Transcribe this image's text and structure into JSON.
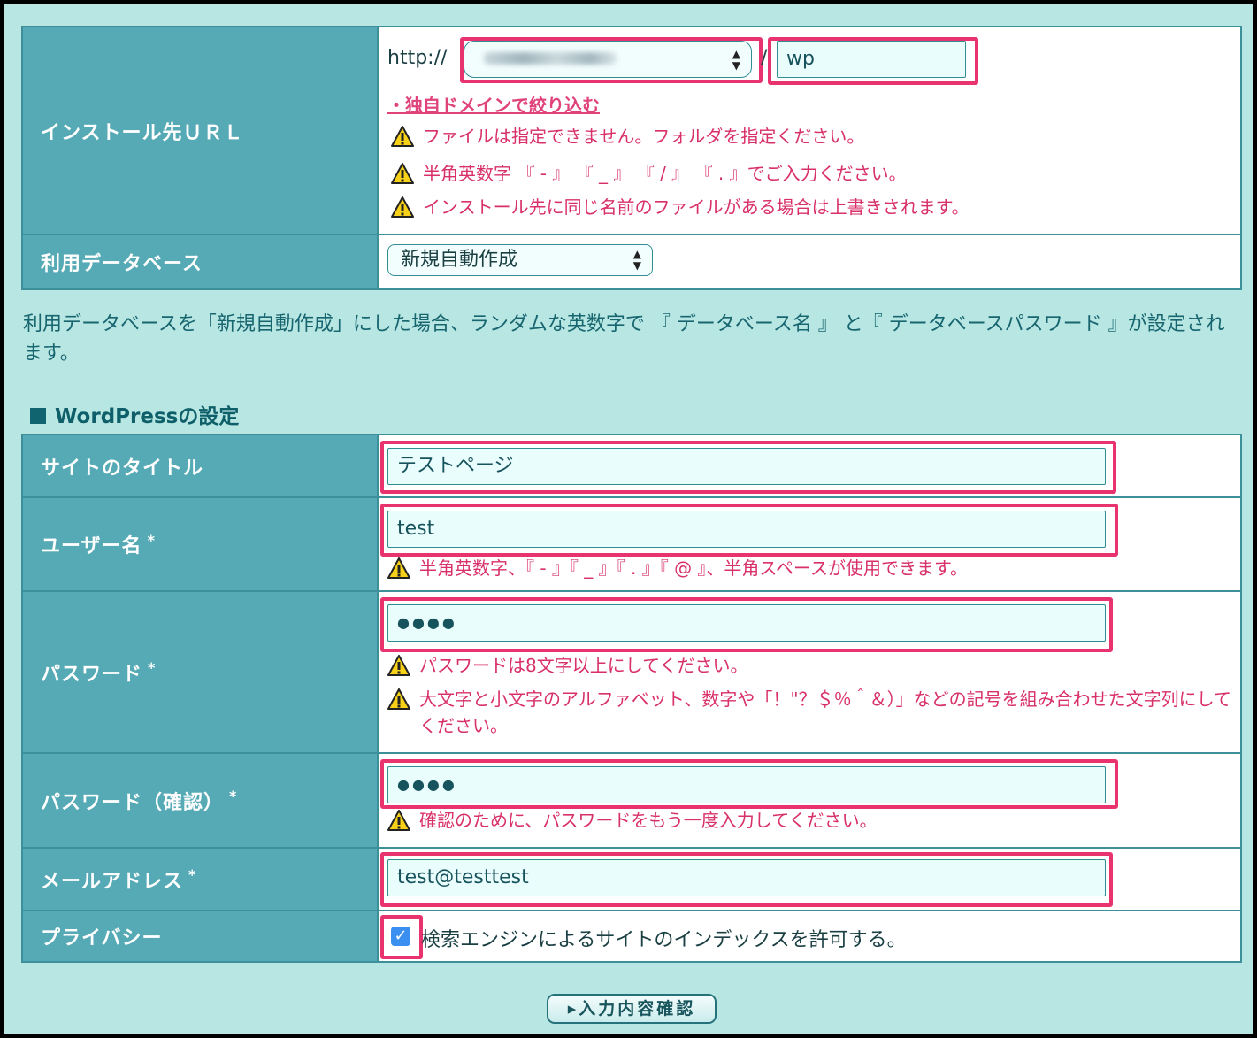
{
  "install": {
    "label": "インストール先ＵＲＬ",
    "prefix": "http://",
    "domain_value": "",
    "slash": "/",
    "folder_value": "wp",
    "filter_link": "・独自ドメインで絞り込む",
    "notes": [
      "ファイルは指定できません。フォルダを指定ください。",
      "半角英数字 『 - 』 『 _ 』 『 / 』 『 . 』でご入力ください。",
      "インストール先に同じ名前のファイルがある場合は上書きされます。"
    ]
  },
  "database": {
    "label": "利用データベース",
    "selected": "新規自動作成"
  },
  "database_note": "利用データベースを「新規自動作成」にした場合、ランダムな英数字で 『 データベース名 』 と『 データベースパスワード 』が設定されます。",
  "section_title": "WordPressの設定",
  "site_title": {
    "label": "サイトのタイトル",
    "value": "テストページ"
  },
  "username": {
    "label": "ユーザー名",
    "required_mark": "*",
    "value": "test",
    "note": "半角英数字、『 - 』『 _ 』『 . 』『 @ 』、半角スペースが使用できます。"
  },
  "password": {
    "label": "パスワード",
    "required_mark": "*",
    "value": "●●●●",
    "notes": [
      "パスワードは8文字以上にしてください。",
      "大文字と小文字のアルファベット、数字や「！\"？＄％＾＆）」などの記号を組み合わせた文字列にしてください。"
    ]
  },
  "password_confirm": {
    "label": "パスワード（確認）",
    "required_mark": "*",
    "value": "●●●●",
    "note": "確認のために、パスワードをもう一度入力してください。"
  },
  "email": {
    "label": "メールアドレス",
    "required_mark": "*",
    "value": "test@testtest"
  },
  "privacy": {
    "label": "プライバシー",
    "checked": true,
    "checkbox_label": "検索エンジンによるサイトのインデックスを許可する。"
  },
  "confirm_button": "▸入力内容確認",
  "colors": {
    "highlight": "#e8336f",
    "label_bg": "#56aab5",
    "page_bg": "#b7e6e3",
    "note_text": "#d8306a"
  }
}
